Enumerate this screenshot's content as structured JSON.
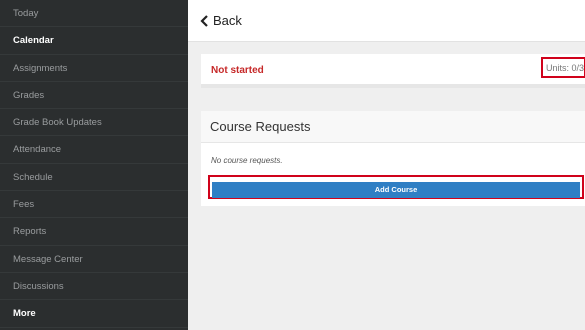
{
  "sidebar": {
    "items": [
      {
        "label": "Today"
      },
      {
        "label": "Calendar"
      },
      {
        "label": "Assignments"
      },
      {
        "label": "Grades"
      },
      {
        "label": "Grade Book Updates"
      },
      {
        "label": "Attendance"
      },
      {
        "label": "Schedule"
      },
      {
        "label": "Fees"
      },
      {
        "label": "Reports"
      },
      {
        "label": "Message Center"
      },
      {
        "label": "Discussions"
      },
      {
        "label": "More"
      }
    ]
  },
  "header": {
    "back_label": "Back"
  },
  "status": {
    "text": "Not started",
    "units": "Units: 0/3"
  },
  "requests": {
    "title": "Course Requests",
    "empty_text": "No course requests.",
    "add_button_label": "Add Course"
  },
  "colors": {
    "accent": "#2f7fc4",
    "status_red": "#c62828",
    "highlight": "#d0021b",
    "sidebar_bg": "#2b2e2f"
  }
}
